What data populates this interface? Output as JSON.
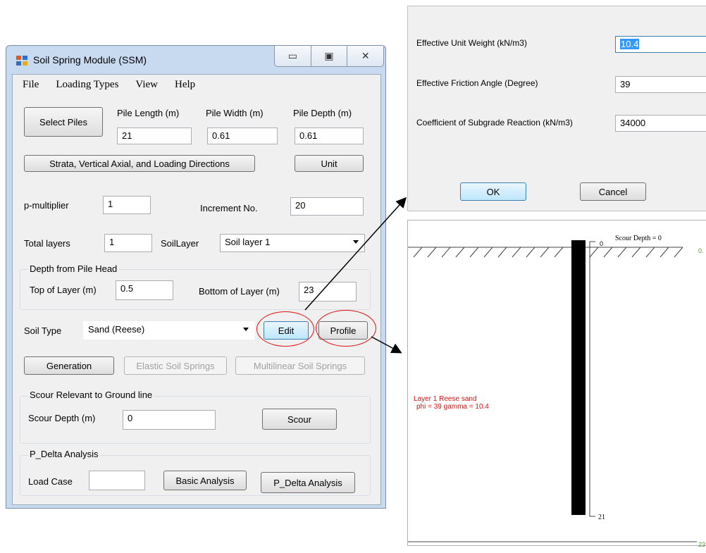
{
  "window": {
    "title": "Soil Spring Module (SSM)",
    "menu": [
      "File",
      "Loading Types",
      "View",
      "Help"
    ]
  },
  "pile": {
    "select_label": "Select Piles",
    "length_label": "Pile Length (m)",
    "length_value": "21",
    "width_label": "Pile Width (m)",
    "width_value": "0.61",
    "depth_label": "Pile Depth (m)",
    "depth_value": "0.61"
  },
  "strata_button": "Strata, Vertical Axial, and Loading Directions",
  "unit_button": "Unit",
  "pmult": {
    "label": "p-multiplier",
    "value": "1"
  },
  "increment": {
    "label": "Increment No.",
    "value": "20"
  },
  "layers": {
    "total_label": "Total layers",
    "total_value": "1",
    "soil_layer_label": "SoilLayer",
    "soil_layer_value": "Soil layer 1"
  },
  "depth_group": {
    "legend": "Depth from Pile Head",
    "top_label": "Top of Layer (m)",
    "top_value": "0.5",
    "bottom_label": "Bottom of Layer (m)",
    "bottom_value": "23"
  },
  "soil_type": {
    "label": "Soil Type",
    "value": "Sand (Reese)",
    "edit": "Edit",
    "profile": "Profile"
  },
  "springs": {
    "generation": "Generation",
    "elastic": "Elastic Soil Springs",
    "multilinear": "Multilinear Soil Springs"
  },
  "scour_group": {
    "legend": "Scour Relevant to Ground line",
    "depth_label": "Scour Depth (m)",
    "depth_value": "0",
    "button": "Scour"
  },
  "pdelta_group": {
    "legend": "P_Delta Analysis",
    "load_case_label": "Load Case",
    "load_case_value": "",
    "basic": "Basic Analysis",
    "pdelta": "P_Delta Analysis"
  },
  "dialog": {
    "unit_weight_label": "Effective Unit Weight (kN/m3)",
    "unit_weight_value": "10.4",
    "friction_label": "Effective Friction Angle (Degree)",
    "friction_value": "39",
    "subgrade_label": "Coefficient of Subgrade Reaction (kN/m3)",
    "subgrade_value": "34000",
    "ok": "OK",
    "cancel": "Cancel"
  },
  "profile": {
    "scour_text": "Scour Depth = 0",
    "top_tick": "0",
    "right_top": "0.",
    "layer_line1": "Layer 1 Reese sand",
    "layer_line2": "phi = 39 gamma = 10.4",
    "bottom_tick": "21",
    "right_bottom": "23"
  },
  "colors": {
    "highlight": "#e01010",
    "layer_text": "#e01010",
    "green_text": "#4a9a2a"
  }
}
